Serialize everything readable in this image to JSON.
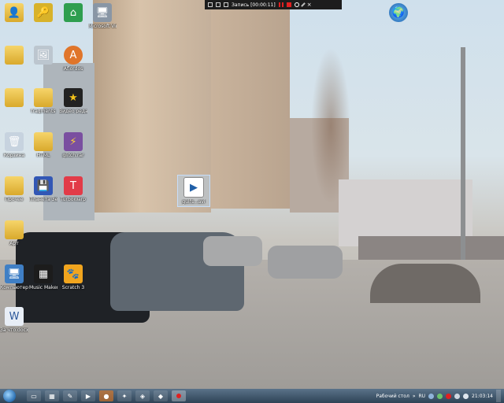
{
  "recorder": {
    "title": "Запись [00:00:11]"
  },
  "icons": [
    {
      "label": "",
      "glyph": "👤"
    },
    {
      "label": "",
      "glyph": "🔑"
    },
    {
      "label": "",
      "glyph": "⌂"
    },
    {
      "label": "Microsoft Virtual PC",
      "glyph": "🖥"
    },
    {
      "label": "",
      "glyph": ""
    },
    {
      "label": "",
      "glyph": "🖼"
    },
    {
      "label": "Aflordos",
      "glyph": "A"
    },
    {
      "label": "",
      "glyph": ""
    },
    {
      "label": "fragments",
      "glyph": ""
    },
    {
      "label": "Видео редакт...",
      "glyph": "★"
    },
    {
      "label": "Корзина",
      "glyph": "🗑"
    },
    {
      "label": "HTML",
      "glyph": ""
    },
    {
      "label": "glitch.rar",
      "glyph": "⚡"
    },
    {
      "label": "Прочее",
      "glyph": ""
    },
    {
      "label": "Планета Земля",
      "glyph": "💾"
    },
    {
      "label": "TurboWarp",
      "glyph": "T"
    },
    {
      "label": "Арт",
      "glyph": ""
    },
    {
      "label": "Компьютер",
      "glyph": "🖥"
    },
    {
      "label": "Music Maker...",
      "glyph": "▦"
    },
    {
      "label": "Scratch 3",
      "glyph": "🐾"
    },
    {
      "label": "За что.docx",
      "glyph": "W"
    },
    {
      "label": "",
      "glyph": "🌍"
    },
    {
      "label": "gulfs...avi",
      "glyph": "▶"
    }
  ],
  "taskbar": {
    "tray_label": "Рабочий стол",
    "lang": "RU",
    "time": "21:03:14"
  },
  "colors": {
    "taskbar": "#3f5569",
    "folder": "#e3b842",
    "record": "#e02020"
  }
}
